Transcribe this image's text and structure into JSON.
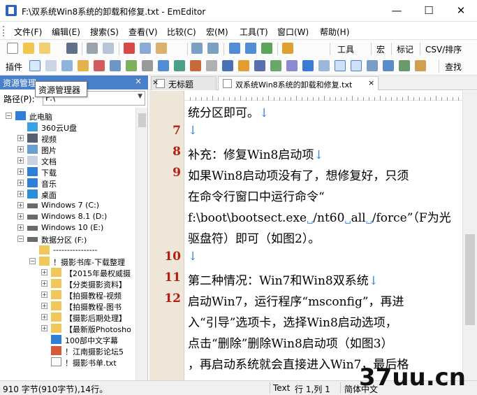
{
  "window": {
    "title": "F:\\双系统Win8系统的卸载和修复.txt - EmEditor",
    "minimize_symbol": "—",
    "maximize_symbol": "☐",
    "close_symbol": "✕"
  },
  "menu": [
    "文件(F)",
    "编辑(E)",
    "搜索(S)",
    "查看(V)",
    "比较(C)",
    "宏(M)",
    "工具(T)",
    "窗口(W)",
    "帮助(H)"
  ],
  "toolbar1": {
    "tools_label": "工具",
    "macro_label": "宏",
    "markers_label": "标记",
    "csv_label": "CSV/排序"
  },
  "toolbar2": {
    "plugins_label": "插件",
    "search_label": "查找"
  },
  "explorer": {
    "header": "资源管理",
    "close_symbol": "×",
    "tooltip": "资源管理器",
    "path_label": "路径(P):",
    "path_value": "F:\\",
    "tree": [
      {
        "label": "此电脑",
        "icon": "computer-icon"
      },
      {
        "label": "360云U盘",
        "icon": "cloud-drive-icon"
      },
      {
        "label": "视频",
        "icon": "video-folder-icon"
      },
      {
        "label": "图片",
        "icon": "picture-folder-icon"
      },
      {
        "label": "文档",
        "icon": "document-folder-icon"
      },
      {
        "label": "下载",
        "icon": "download-folder-icon"
      },
      {
        "label": "音乐",
        "icon": "music-folder-icon"
      },
      {
        "label": "桌面",
        "icon": "desktop-folder-icon"
      },
      {
        "label": "Windows 7 (C:)",
        "icon": "drive-icon"
      },
      {
        "label": "Windows 8.1 (D:)",
        "icon": "drive-icon"
      },
      {
        "label": "Windows 10 (E:)",
        "icon": "drive-icon"
      },
      {
        "label": "数据分区 (F:)",
        "icon": "drive-icon"
      },
      {
        "label": "----------------",
        "icon": "folder-icon"
      },
      {
        "label": "！摄影书库-下载整理",
        "icon": "folder-icon"
      },
      {
        "label": "【2015年最权威摄",
        "icon": "folder-icon"
      },
      {
        "label": "【分类摄影资料】",
        "icon": "folder-icon"
      },
      {
        "label": "【拍摄教程-视频",
        "icon": "folder-icon"
      },
      {
        "label": "【拍摄教程-图书",
        "icon": "folder-icon"
      },
      {
        "label": "【摄影后期处理】",
        "icon": "folder-icon"
      },
      {
        "label": "【最新版Photosho",
        "icon": "folder-icon"
      },
      {
        "label": "100部中文字幕",
        "icon": "ie-file-icon"
      },
      {
        "label": "！江南摄影论坛5",
        "icon": "png-file-icon"
      },
      {
        "label": "！摄影书单.txt",
        "icon": "text-file-icon"
      }
    ]
  },
  "tabs": [
    {
      "label": "无标题",
      "close_symbol": "×"
    },
    {
      "label": "双系统Win8系统的卸载和修复.txt",
      "close_symbol": "×"
    }
  ],
  "editor": {
    "lines": [
      {
        "num": "",
        "text": "统分区即可。"
      },
      {
        "num": "7",
        "text": ""
      },
      {
        "num": "8",
        "text": "补充：修复Win8启动项"
      },
      {
        "num": "9",
        "text": "如果Win8启动项没有了，想修复好，只须"
      },
      {
        "num": "",
        "text": "在命令行窗口中运行命令“"
      },
      {
        "num": "",
        "text": "f:\\boot\\bootsect.exe /nt60 all /force”（F为光"
      },
      {
        "num": "",
        "text": "驱盘符）即可（如图2）。"
      },
      {
        "num": "10",
        "text": ""
      },
      {
        "num": "11",
        "text": "第二种情况：Win7和Win8双系统"
      },
      {
        "num": "12",
        "text": "启动Win7，运行程序“msconfig”，再进"
      },
      {
        "num": "",
        "text": "入“引导”选项卡，选择Win8启动选项，"
      },
      {
        "num": "",
        "text": "点击“删除”删除Win8启动项（如图3）"
      },
      {
        "num": "",
        "text": "，再启动系统就会直接进入Win7，最后格"
      }
    ],
    "eol_mark": "↓"
  },
  "status": {
    "chars": "910 字节(910字节),14行。",
    "mode": "Text",
    "position": "行 1,列 1",
    "encoding": "简体中文"
  },
  "watermark": "37uu.cn",
  "colors": {
    "accent": "#4a7fc9",
    "line_number": "#b21f10",
    "gutter": "#efe6da",
    "eol": "#3f7fd8"
  }
}
